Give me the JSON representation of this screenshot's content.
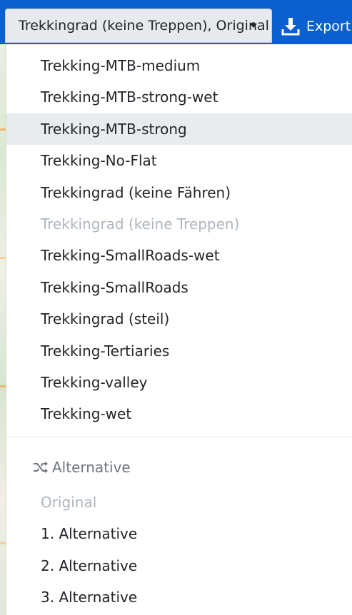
{
  "toolbar": {
    "profile_select_label": "Trekkingrad (keine Treppen), Original",
    "export_label": "Export"
  },
  "colors": {
    "toolbar_bg": "#0b5fcf",
    "select_bg": "#e7e9ed",
    "active_item_bg": "#e9ecef",
    "disabled_text": "#adb5bd",
    "header_text": "#6c757d"
  },
  "icons": {
    "caret": "caret-down-icon",
    "export": "download-icon",
    "alternative": "shuffle-icon"
  },
  "profiles": [
    {
      "label": "Trekking-MTB-medium",
      "state": "normal"
    },
    {
      "label": "Trekking-MTB-strong-wet",
      "state": "normal"
    },
    {
      "label": "Trekking-MTB-strong",
      "state": "active"
    },
    {
      "label": "Trekking-No-Flat",
      "state": "normal"
    },
    {
      "label": "Trekkingrad (keine Fähren)",
      "state": "normal"
    },
    {
      "label": "Trekkingrad (keine Treppen)",
      "state": "disabled"
    },
    {
      "label": "Trekking-SmallRoads-wet",
      "state": "normal"
    },
    {
      "label": "Trekking-SmallRoads",
      "state": "normal"
    },
    {
      "label": "Trekkingrad (steil)",
      "state": "normal"
    },
    {
      "label": "Trekking-Tertiaries",
      "state": "normal"
    },
    {
      "label": "Trekking-valley",
      "state": "normal"
    },
    {
      "label": "Trekking-wet",
      "state": "normal"
    }
  ],
  "alternatives": {
    "header": "Alternative",
    "items": [
      {
        "label": "Original",
        "state": "disabled"
      },
      {
        "label": "1. Alternative",
        "state": "normal"
      },
      {
        "label": "2. Alternative",
        "state": "normal"
      },
      {
        "label": "3. Alternative",
        "state": "normal"
      }
    ]
  }
}
